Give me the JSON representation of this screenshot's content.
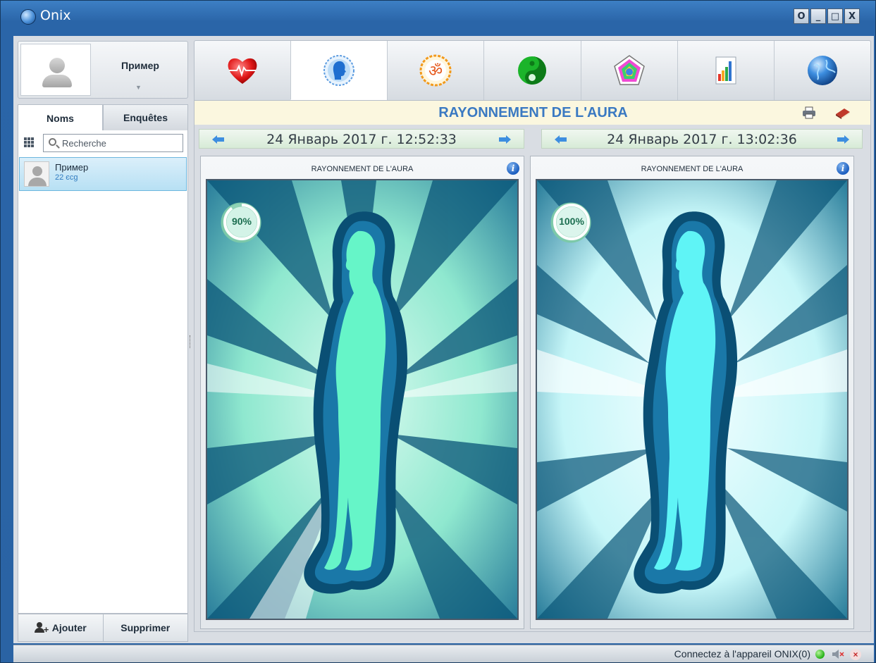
{
  "window": {
    "title": "Onix",
    "buttons": [
      "O",
      "_",
      "□",
      "X"
    ]
  },
  "sidebar": {
    "profile_name": "Пример",
    "tabs": [
      {
        "label": "Noms",
        "active": true
      },
      {
        "label": "Enquêtes",
        "active": false
      }
    ],
    "search": {
      "placeholder": "Recherche",
      "value": ""
    },
    "list": [
      {
        "name": "Пример",
        "sub": "22 єсg"
      }
    ],
    "footer": {
      "add_label": "Ajouter",
      "delete_label": "Supprimer"
    }
  },
  "toolbar": {
    "icons": [
      "heart-icon",
      "head-aura-icon",
      "om-icon",
      "yin-yang-icon",
      "pentagon-icon",
      "bar-chart-icon",
      "globe-icon"
    ],
    "active_index": 1
  },
  "main": {
    "title": "RAYONNEMENT DE L'AURA",
    "dates": {
      "left": "24 Январь 2017 г. 12:52:33",
      "right": "24 Январь 2017 г. 13:02:36"
    },
    "panels": [
      {
        "title": "RAYONNEMENT DE L'AURA",
        "percent": "90%",
        "percent_value": 0.9,
        "body_color": "#66f5c8",
        "bg_color": "#8fe8cf"
      },
      {
        "title": "RAYONNEMENT DE L'AURA",
        "percent": "100%",
        "percent_value": 1.0,
        "body_color": "#5ff4f6",
        "bg_color": "#c6f6f8"
      }
    ],
    "aura_color": "#0a4f74"
  },
  "status": {
    "text": "Connectez à l'appareil ONIX(0)",
    "connection_color": "#23b015"
  }
}
